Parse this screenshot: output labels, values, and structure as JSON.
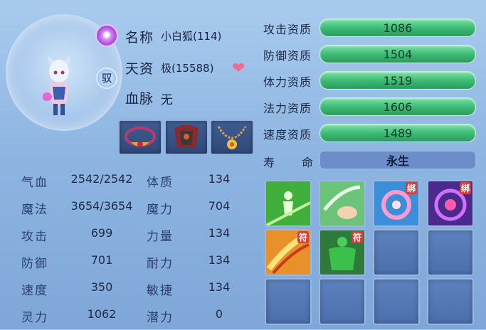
{
  "pet": {
    "name_label": "名称",
    "name_value": "小白狐(114)",
    "aptitude_label": "天资",
    "aptitude_value": "极(15588)",
    "bloodline_label": "血脉",
    "bloodline_value": "无",
    "bind_badge": "驭"
  },
  "stats": [
    {
      "label": "气血",
      "value": "2542/2542",
      "label2": "体质",
      "value2": "134"
    },
    {
      "label": "魔法",
      "value": "3654/3654",
      "label2": "魔力",
      "value2": "704"
    },
    {
      "label": "攻击",
      "value": "699",
      "label2": "力量",
      "value2": "134"
    },
    {
      "label": "防御",
      "value": "701",
      "label2": "耐力",
      "value2": "134"
    },
    {
      "label": "速度",
      "value": "350",
      "label2": "敏捷",
      "value2": "134"
    },
    {
      "label": "灵力",
      "value": "1062",
      "label2": "潜力",
      "value2": "0"
    }
  ],
  "qualities": [
    {
      "label": "攻击资质",
      "value": "1086"
    },
    {
      "label": "防御资质",
      "value": "1504"
    },
    {
      "label": "体力资质",
      "value": "1519"
    },
    {
      "label": "法力资质",
      "value": "1606"
    },
    {
      "label": "速度资质",
      "value": "1489"
    }
  ],
  "lifespan": {
    "label_a": "寿",
    "label_b": "命",
    "value": "永生"
  },
  "skills": [
    {
      "icon": "green-figure-skill-icon"
    },
    {
      "icon": "pointing-hand-skill-icon"
    },
    {
      "icon": "pink-swirl-skill-icon",
      "tag": "绑"
    },
    {
      "icon": "purple-vortex-skill-icon",
      "tag": "绑"
    },
    {
      "icon": "fire-slash-skill-icon",
      "tag": "符"
    },
    {
      "icon": "green-muscle-skill-icon",
      "tag": "符"
    }
  ],
  "colors": {
    "quality_bar": "#3ebc76",
    "life_bar": "#6c8dc9",
    "heart": "#f06b8c"
  }
}
